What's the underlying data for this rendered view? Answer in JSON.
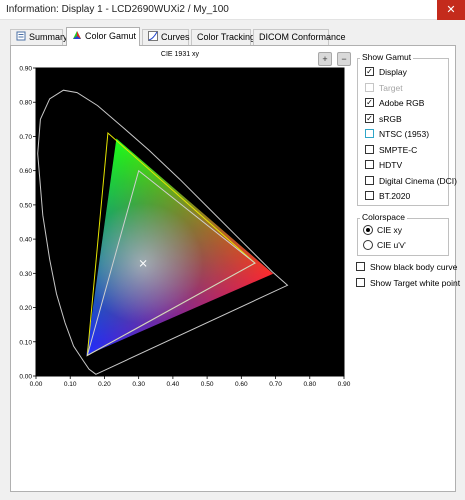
{
  "window": {
    "title": "Information: Display 1 - LCD2690WUXi2 / My_100",
    "close_glyph": "✕"
  },
  "tabs": [
    {
      "label": "Summary",
      "icon": "summary-icon",
      "active": false
    },
    {
      "label": "Color Gamut",
      "icon": "color-gamut-icon",
      "active": true
    },
    {
      "label": "Curves",
      "icon": "curves-icon",
      "active": false
    },
    {
      "label": "Color Tracking",
      "icon": "",
      "active": false
    },
    {
      "label": "DICOM Conformance",
      "icon": "",
      "active": false
    }
  ],
  "toolbar": {
    "zoom_in": "+",
    "zoom_out": "−"
  },
  "chart_data": {
    "type": "scatter",
    "title": "CIE 1931 xy",
    "xlim": [
      0.0,
      0.9
    ],
    "ylim": [
      0.0,
      0.9
    ],
    "x_ticks": [
      "0.00",
      "0.10",
      "0.20",
      "0.30",
      "0.40",
      "0.50",
      "0.60",
      "0.70",
      "0.80",
      "0.90"
    ],
    "y_ticks": [
      "0.00",
      "0.10",
      "0.20",
      "0.30",
      "0.40",
      "0.50",
      "0.60",
      "0.70",
      "0.80",
      "0.90"
    ],
    "background": "#000000",
    "grid": false,
    "spectral_locus": [
      [
        0.175,
        0.005
      ],
      [
        0.155,
        0.02
      ],
      [
        0.138,
        0.045
      ],
      [
        0.11,
        0.087
      ],
      [
        0.085,
        0.155
      ],
      [
        0.06,
        0.24
      ],
      [
        0.04,
        0.34
      ],
      [
        0.02,
        0.47
      ],
      [
        0.005,
        0.65
      ],
      [
        0.013,
        0.75
      ],
      [
        0.04,
        0.81
      ],
      [
        0.08,
        0.835
      ],
      [
        0.12,
        0.828
      ],
      [
        0.18,
        0.79
      ],
      [
        0.25,
        0.73
      ],
      [
        0.33,
        0.66
      ],
      [
        0.42,
        0.575
      ],
      [
        0.51,
        0.485
      ],
      [
        0.6,
        0.395
      ],
      [
        0.69,
        0.305
      ],
      [
        0.735,
        0.265
      ]
    ],
    "gamuts": [
      {
        "name": "Display",
        "color": "rainbow",
        "points": [
          [
            0.693,
            0.299
          ],
          [
            0.235,
            0.694
          ],
          [
            0.147,
            0.06
          ]
        ]
      },
      {
        "name": "Adobe RGB",
        "color": "#e6e600",
        "points": [
          [
            0.64,
            0.33
          ],
          [
            0.21,
            0.71
          ],
          [
            0.15,
            0.06
          ]
        ]
      },
      {
        "name": "sRGB",
        "color": "#cfcfcf",
        "points": [
          [
            0.64,
            0.33
          ],
          [
            0.3,
            0.6
          ],
          [
            0.15,
            0.06
          ]
        ]
      }
    ],
    "white_point": [
      0.313,
      0.329
    ]
  },
  "show_gamut": {
    "title": "Show Gamut",
    "items": [
      {
        "label": "Display",
        "checked": true,
        "disabled": false,
        "style": "normal"
      },
      {
        "label": "Target",
        "checked": false,
        "disabled": true,
        "style": "normal"
      },
      {
        "label": "Adobe RGB",
        "checked": true,
        "disabled": false,
        "style": "normal"
      },
      {
        "label": "sRGB",
        "checked": true,
        "disabled": false,
        "style": "normal"
      },
      {
        "label": "NTSC (1953)",
        "checked": false,
        "disabled": false,
        "style": "cyan"
      },
      {
        "label": "SMPTE-C",
        "checked": false,
        "disabled": false,
        "style": "normal"
      },
      {
        "label": "HDTV",
        "checked": false,
        "disabled": false,
        "style": "normal"
      },
      {
        "label": "Digital Cinema (DCI)",
        "checked": false,
        "disabled": false,
        "style": "normal"
      },
      {
        "label": "BT.2020",
        "checked": false,
        "disabled": false,
        "style": "normal"
      }
    ]
  },
  "colorspace": {
    "title": "Colorspace",
    "options": [
      {
        "label": "CIE xy",
        "selected": true
      },
      {
        "label": "CIE u'v'",
        "selected": false
      }
    ]
  },
  "options": [
    {
      "label": "Show black body curve",
      "checked": false
    },
    {
      "label": "Show Target white point",
      "checked": false
    }
  ],
  "colors": {
    "close_bg": "#c42b1c",
    "adobe_rgb": "#e6e600",
    "srgb": "#cfcfcf",
    "white_point": "#ffffff"
  }
}
